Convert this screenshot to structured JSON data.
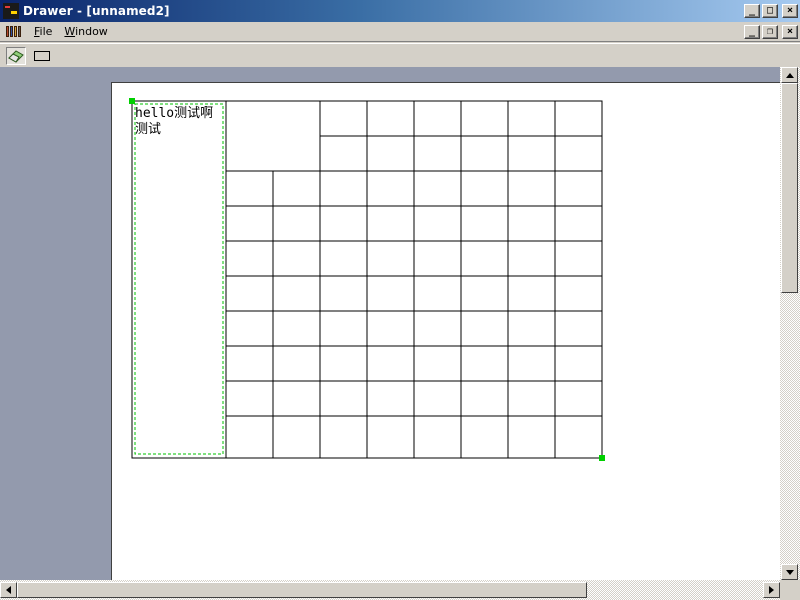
{
  "window": {
    "title": "Drawer - [unnamed2]",
    "controls": [
      "_",
      "□",
      "×"
    ]
  },
  "menu": {
    "items": [
      {
        "label_rest": "ile",
        "label_accel": "F"
      },
      {
        "label_rest": "indow",
        "label_accel": "W"
      }
    ],
    "mdi_controls": [
      "_",
      "❐",
      "×"
    ]
  },
  "toolbar": {
    "tools": [
      "eraser-icon",
      "rectangle-icon"
    ]
  },
  "canvas": {
    "text_line1": "hello测试啊",
    "text_line2": "测试",
    "grid_columns": 8,
    "grid_rows": 10,
    "merged_cell": "top-left 2x2 of grid",
    "selection_handle_color": "#00c000",
    "dashed_border_color": "#00c000"
  },
  "colors": {
    "title_gradient_start": "#0a246a",
    "mdi_background": "#939aad",
    "chrome": "#d4d0c8"
  }
}
